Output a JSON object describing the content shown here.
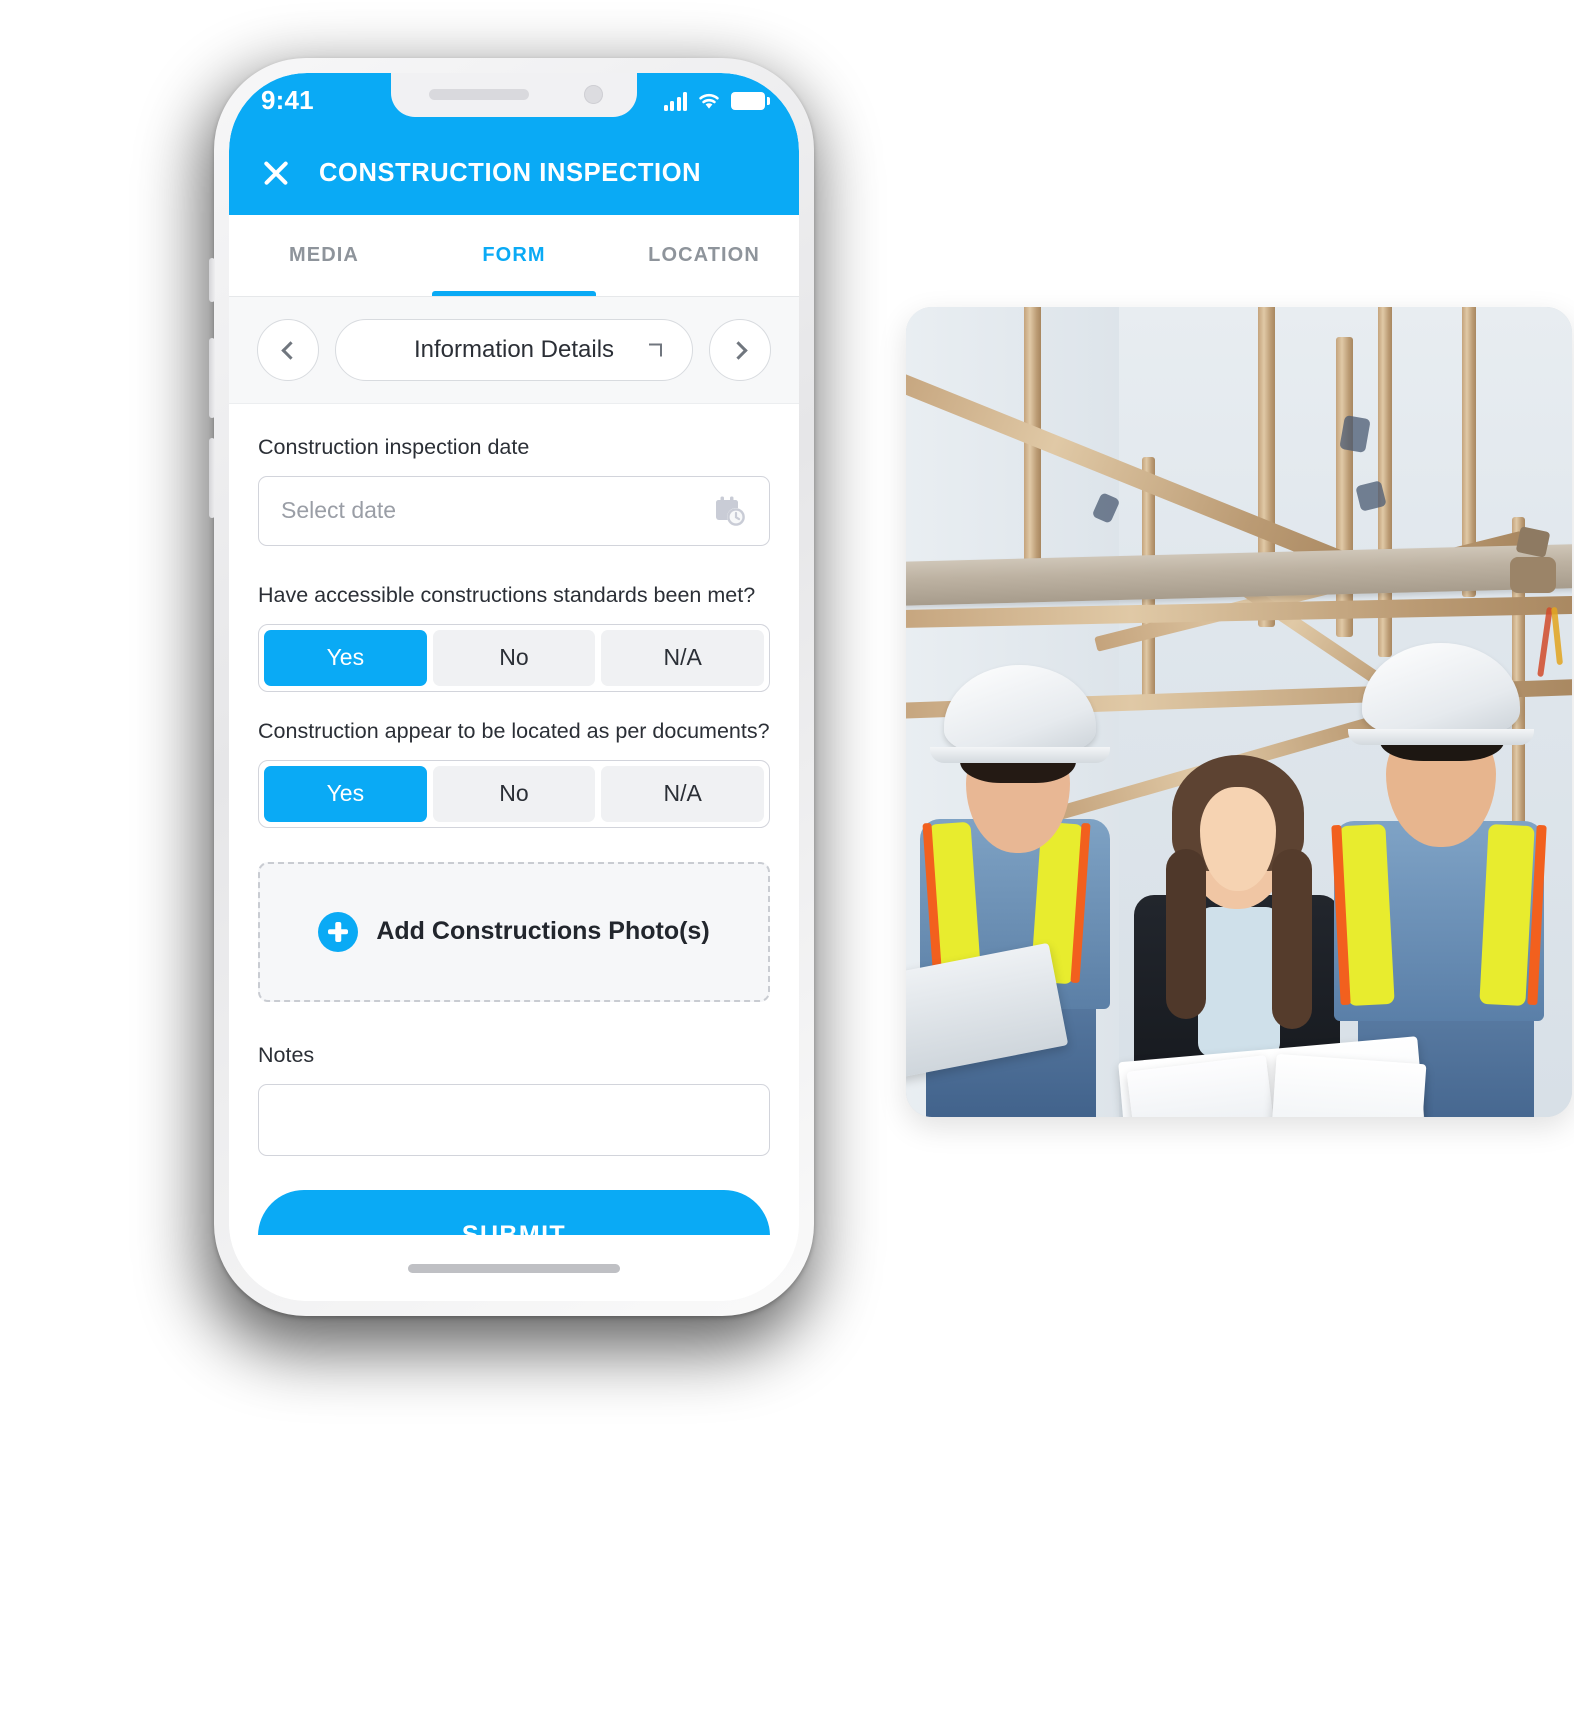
{
  "status_bar": {
    "time": "9:41",
    "icons": [
      "signal-bars-icon",
      "wifi-icon",
      "battery-icon"
    ]
  },
  "app_bar": {
    "close_icon": "close-icon",
    "title": "CONSTRUCTION INSPECTION"
  },
  "tabs": [
    {
      "label": "MEDIA",
      "active": false
    },
    {
      "label": "FORM",
      "active": true
    },
    {
      "label": "LOCATION",
      "active": false
    }
  ],
  "section_nav": {
    "prev_icon": "chevron-left-icon",
    "next_icon": "chevron-right-icon",
    "caret_icon": "chevron-down-icon",
    "selected_section": "Information Details"
  },
  "form": {
    "date_field": {
      "label": "Construction inspection date",
      "placeholder": "Select date",
      "value": "",
      "icon": "calendar-clock-icon"
    },
    "questions": [
      {
        "label": "Have accessible constructions standards been met?",
        "options": [
          "Yes",
          "No",
          "N/A"
        ],
        "selected": "Yes"
      },
      {
        "label": "Construction appear to be located as per documents?",
        "options": [
          "Yes",
          "No",
          "N/A"
        ],
        "selected": "Yes"
      }
    ],
    "photo_upload": {
      "label": "Add Constructions Photo(s)",
      "icon": "plus-circle-icon"
    },
    "notes": {
      "label": "Notes",
      "value": "",
      "placeholder": ""
    },
    "submit_label": "SUBMIT"
  },
  "photo_card": {
    "alt": "Three construction workers in hard hats and safety vests reviewing plans at a scaffolded site"
  },
  "colors": {
    "accent": "#0aaaf5",
    "tab_inactive": "#8e949b",
    "border": "#d2d4db",
    "surface": "#f7f8f9"
  }
}
